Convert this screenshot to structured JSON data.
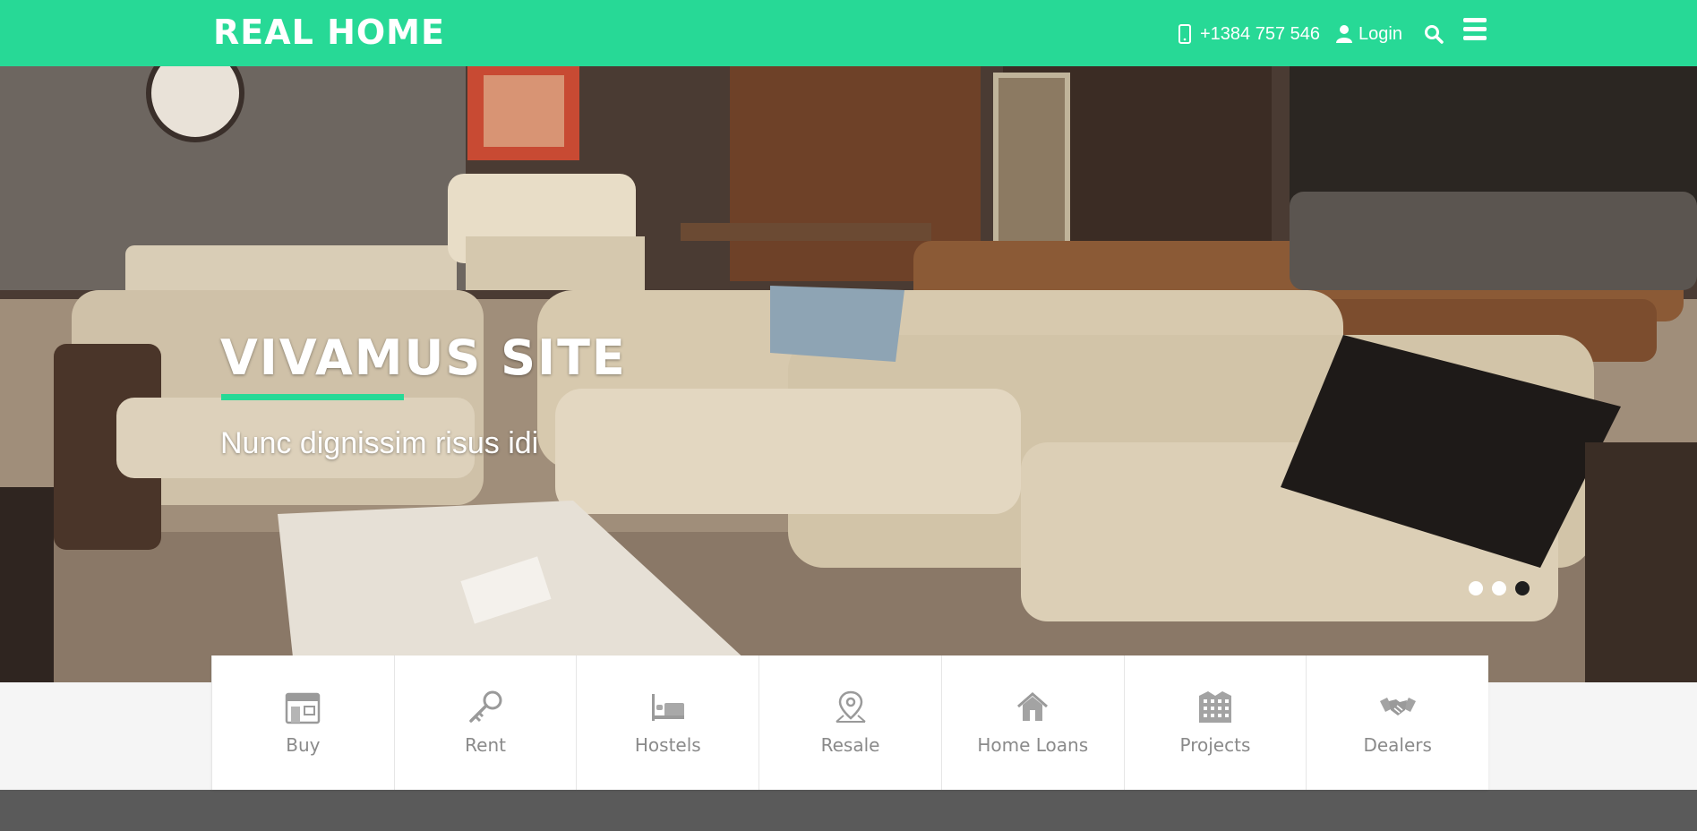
{
  "header": {
    "logo": "REAL HOME",
    "phone": "+1384 757 546",
    "login_label": "Login",
    "accent_color": "#27d996"
  },
  "hero": {
    "title": "VIVAMUS SITE",
    "subtitle": "Nunc dignissim risus idi",
    "slides": 3,
    "active_slide": 3
  },
  "categories": [
    {
      "label": "Buy",
      "icon": "storefront-icon"
    },
    {
      "label": "Rent",
      "icon": "key-icon"
    },
    {
      "label": "Hostels",
      "icon": "bed-icon"
    },
    {
      "label": "Resale",
      "icon": "location-pin-icon"
    },
    {
      "label": "Home Loans",
      "icon": "house-icon"
    },
    {
      "label": "Projects",
      "icon": "building-icon"
    },
    {
      "label": "Dealers",
      "icon": "handshake-icon"
    }
  ]
}
